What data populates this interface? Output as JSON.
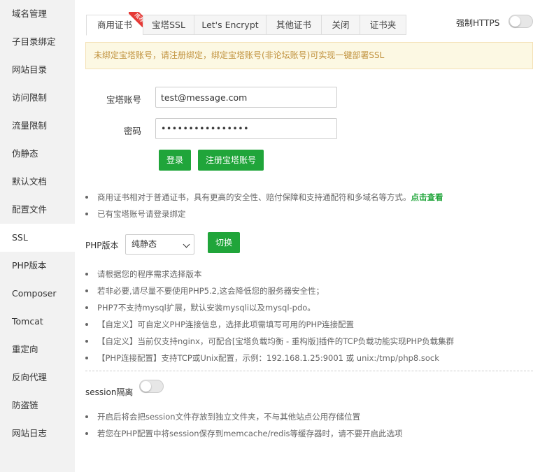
{
  "sidebar": {
    "items": [
      {
        "label": "域名管理"
      },
      {
        "label": "子目录绑定"
      },
      {
        "label": "网站目录"
      },
      {
        "label": "访问限制"
      },
      {
        "label": "流量限制"
      },
      {
        "label": "伪静态"
      },
      {
        "label": "默认文档"
      },
      {
        "label": "配置文件"
      },
      {
        "label": "SSL"
      },
      {
        "label": "PHP版本"
      },
      {
        "label": "Composer"
      },
      {
        "label": "Tomcat"
      },
      {
        "label": "重定向"
      },
      {
        "label": "反向代理"
      },
      {
        "label": "防盗链"
      },
      {
        "label": "网站日志"
      }
    ],
    "active": "SSL"
  },
  "tabs": {
    "items": [
      {
        "label": "商用证书",
        "badge": "推荐"
      },
      {
        "label": "宝塔SSL"
      },
      {
        "label": "Let's Encrypt"
      },
      {
        "label": "其他证书"
      },
      {
        "label": "关闭"
      },
      {
        "label": "证书夹"
      }
    ],
    "active": "商用证书"
  },
  "force_https": {
    "label": "强制HTTPS",
    "enabled": false
  },
  "alert": {
    "text": "未绑定宝塔账号，请注册绑定，绑定宝塔账号(非论坛账号)可实现一键部署SSL"
  },
  "login_form": {
    "account_label": "宝塔账号",
    "account_value": "test@message.com",
    "password_label": "密码",
    "password_value": "••••••••••••••••",
    "login_button": "登录",
    "register_button": "注册宝塔账号"
  },
  "cert_notes": {
    "line1_text": "商用证书相对于普通证书，具有更高的安全性、赔付保障和支持通配符和多域名等方式。",
    "line1_link": "点击查看",
    "line2": "已有宝塔账号请登录绑定"
  },
  "php": {
    "label": "PHP版本",
    "selected": "纯静态",
    "switch_button": "切换",
    "notes": [
      "请根据您的程序需求选择版本",
      "若非必要,请尽量不要使用PHP5.2,这会降低您的服务器安全性；",
      "PHP7不支持mysql扩展，默认安装mysqli以及mysql-pdo。",
      "【自定义】可自定义PHP连接信息，选择此项需填写可用的PHP连接配置",
      "【自定义】当前仅支持nginx，可配合[宝塔负载均衡 - 重构版]插件的TCP负载功能实现PHP负载集群",
      "【PHP连接配置】支持TCP或Unix配置，示例：192.168.1.25:9001 或 unix:/tmp/php8.sock"
    ]
  },
  "session": {
    "label": "session隔离",
    "enabled": false,
    "notes": [
      "开启后将会把session文件存放到独立文件夹，不与其他站点公用存储位置",
      "若您在PHP配置中将session保存到memcache/redis等缓存器时，请不要开启此选项"
    ]
  },
  "colors": {
    "accent": "#20a53a",
    "alert_bg": "#fcf8e3",
    "alert_text": "#c0913c",
    "badge": "#e53935"
  }
}
